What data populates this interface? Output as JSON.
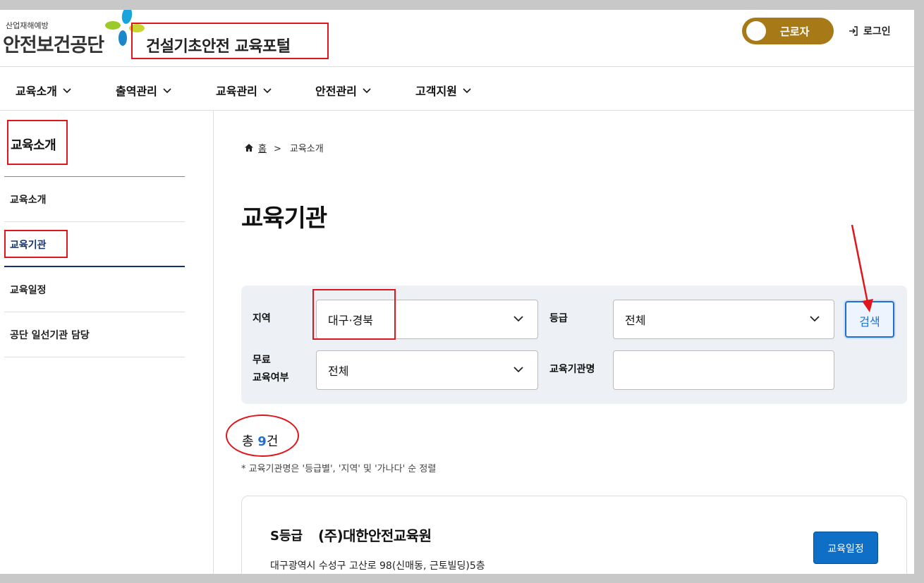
{
  "header": {
    "logo_sub": "산업재해예방",
    "logo_main": "안전보건공단",
    "portal_title": "건설기초안전 교육포털",
    "user_type_toggle": "근로자",
    "login_label": "로그인"
  },
  "nav": {
    "items": [
      {
        "label": "교육소개"
      },
      {
        "label": "출역관리"
      },
      {
        "label": "교육관리"
      },
      {
        "label": "안전관리"
      },
      {
        "label": "고객지원"
      }
    ]
  },
  "sidebar": {
    "title": "교육소개",
    "items": [
      {
        "label": "교육소개",
        "active": false
      },
      {
        "label": "교육기관",
        "active": true
      },
      {
        "label": "교육일정",
        "active": false
      },
      {
        "label": "공단 일선기관 담당",
        "active": false
      }
    ]
  },
  "breadcrumb": {
    "home": "홈",
    "current": "교육소개"
  },
  "page_title": "교육기관",
  "filter": {
    "region_label": "지역",
    "region_value": "대구·경북",
    "grade_label": "등급",
    "grade_value": "전체",
    "free_label_line1": "무료",
    "free_label_line2": "교육여부",
    "free_value": "전체",
    "org_name_label": "교육기관명",
    "org_name_value": "",
    "search_label": "검색"
  },
  "results": {
    "total_prefix": "총 ",
    "total_count": "9",
    "total_suffix": "건",
    "sort_note": "* 교육기관명은 '등급별', '지역' 및 '가나다' 순 정렬"
  },
  "cards": [
    {
      "grade": "S등급",
      "name": "(주)대한안전교육원",
      "address": "대구광역시 수성구 고산로 98(신매동, 근토빌딩)5층",
      "schedule_button": "교육일정"
    }
  ],
  "colors": {
    "annotation_red": "#e0161c",
    "toggle_gold": "#a77a17",
    "primary_blue": "#0f6fc6",
    "active_navy": "#13336e"
  }
}
